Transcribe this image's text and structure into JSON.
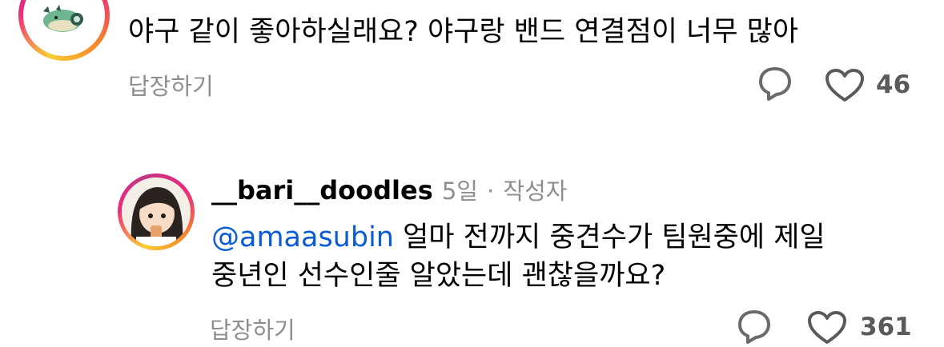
{
  "comment1": {
    "text": "야구 같이 좋아하실래요? 야구랑 밴드 연결점이 너무 많아",
    "reply_label": "답장하기",
    "like_count": "46"
  },
  "comment2": {
    "username": "__bari__doodles",
    "age": "5일",
    "separator": "·",
    "author_badge": "작성자",
    "mention": "@amaasubin",
    "line1_rest": " 얼마 전까지 중견수가 팀원중에 제일",
    "line2": "중년인 선수인줄 알았는데 괜찮을까요?",
    "reply_label": "답장하기",
    "like_count": "361"
  },
  "colors": {
    "mention": "#0a5cd6",
    "muted": "#8e8e8e",
    "ring_start": "#f9ce34",
    "ring_mid": "#ee2a7b"
  }
}
